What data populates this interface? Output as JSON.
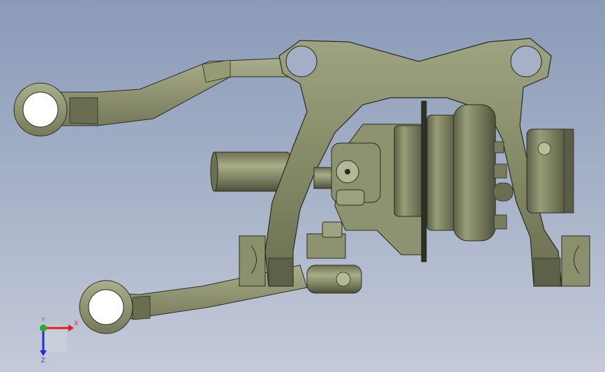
{
  "viewport": {
    "background_top": "#8a9ab8",
    "background_bottom": "#c4cad9",
    "part_color": "#8a8f6c",
    "part_shadow": "#5d6148",
    "part_highlight": "#b6bb95"
  },
  "triad": {
    "x_label": "X",
    "y_label": "Y",
    "z_label": "Z",
    "x_color": "#e0201c",
    "y_color": "#22b022",
    "z_color": "#2030d0"
  }
}
